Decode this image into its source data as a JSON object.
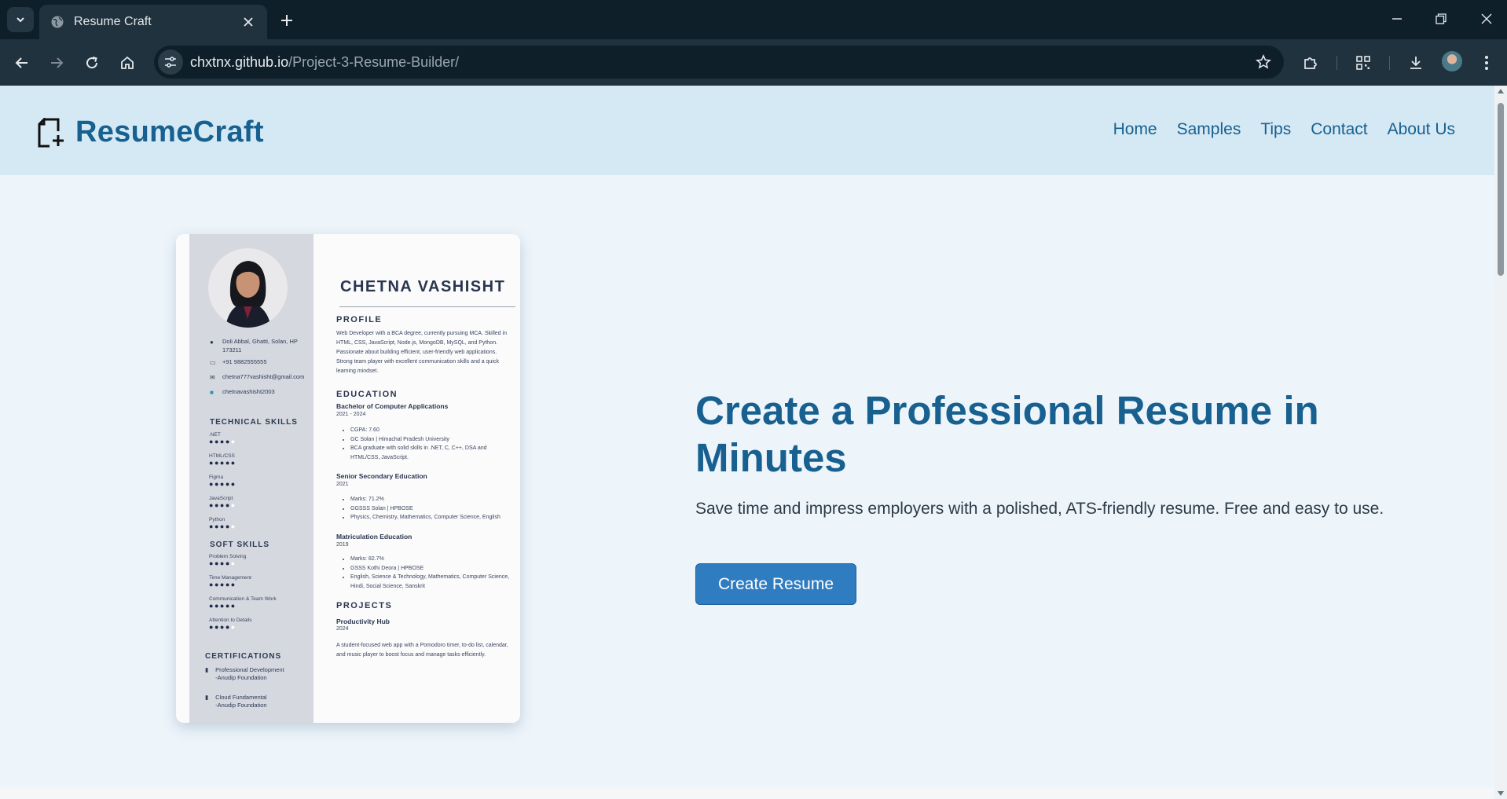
{
  "browser": {
    "tab_title": "Resume Craft",
    "url_host": "chxtnx.github.io",
    "url_path": "/Project-3-Resume-Builder/"
  },
  "header": {
    "logo_text": "ResumeCraft",
    "nav": [
      "Home",
      "Samples",
      "Tips",
      "Contact",
      "About Us"
    ]
  },
  "hero": {
    "title": "Create a Professional Resume in Minutes",
    "subtitle": "Save time and impress employers with a polished, ATS-friendly resume. Free and easy to use.",
    "cta_label": "Create Resume"
  },
  "resume": {
    "name": "CHETNA VASHISHT",
    "contact": {
      "address": "Doli Abbal, Ghatti, Solan, HP 173211",
      "phone": "+91 9882555555",
      "email": "chetna777vashisht@gmail.com",
      "linkedin": "chetnavashisht2003"
    },
    "technical_skills_heading": "TECHNICAL SKILLS",
    "technical_skills": [
      {
        "name": ".NET",
        "level": 4
      },
      {
        "name": "HTML/CSS",
        "level": 5
      },
      {
        "name": "Figma",
        "level": 5
      },
      {
        "name": "JavaScript",
        "level": 4
      },
      {
        "name": "Python",
        "level": 4
      }
    ],
    "soft_skills_heading": "SOFT SKILLS",
    "soft_skills": [
      {
        "name": "Problem Solving",
        "level": 4
      },
      {
        "name": "Time Management",
        "level": 5
      },
      {
        "name": "Communication & Team Work",
        "level": 5
      },
      {
        "name": "Attention to Details",
        "level": 4
      }
    ],
    "certifications_heading": "CERTIFICATIONS",
    "certifications": [
      {
        "line1": "Professional Development",
        "line2": "-Anudip Foundation"
      },
      {
        "line1": "Cloud Fundamental",
        "line2": "-Anudip Foundation"
      }
    ],
    "profile_heading": "PROFILE",
    "profile_text": "Web Developer with a BCA degree, currently pursuing MCA. Skilled in HTML, CSS, JavaScript, Node.js, MongoDB, MySQL, and Python. Passionate about building efficient, user-friendly web applications. Strong team player with excellent communication skills and a quick learning mindset.",
    "education_heading": "EDUCATION",
    "education": [
      {
        "degree": "Bachelor of Computer Applications",
        "years": "2021 - 2024",
        "points": [
          "CGPA: 7.60",
          "GC Solan | Himachal Pradesh University",
          "BCA graduate with solid skills in .NET, C, C++, DSA and HTML/CSS, JavaScript."
        ]
      },
      {
        "degree": "Senior Secondary Education",
        "years": "2021",
        "points": [
          "Marks: 71.2%",
          "GGSSS Solan | HPBOSE",
          "Physics, Chemistry, Mathematics, Computer Science, English"
        ]
      },
      {
        "degree": "Matriculation Education",
        "years": "2019",
        "points": [
          "Marks: 82.7%",
          "GSSS Kothi Deora | HPBOSE",
          "English, Science & Technology, Mathematics, Computer Science, Hindi, Social Science, Sanskrit"
        ]
      }
    ],
    "projects_heading": "PROJECTS",
    "project": {
      "title": "Productivity Hub",
      "year": "2024",
      "description": "A student-focused web app with a Pomodoro timer, to-do list, calendar, and music player to boost focus and manage tasks efficiently."
    }
  }
}
